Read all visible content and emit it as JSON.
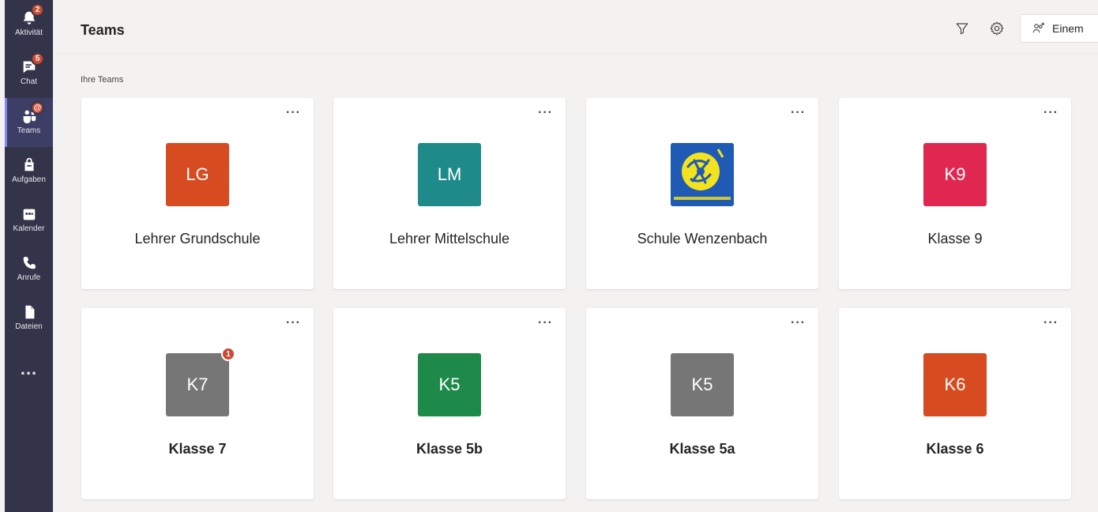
{
  "rail": {
    "items": [
      {
        "label": "Aktivität",
        "badge": "2",
        "icon": "bell-icon"
      },
      {
        "label": "Chat",
        "badge": "5",
        "icon": "chat-icon"
      },
      {
        "label": "Teams",
        "badge": "@",
        "icon": "teams-icon",
        "active": true
      },
      {
        "label": "Aufgaben",
        "badge": "",
        "icon": "assignments-icon"
      },
      {
        "label": "Kalender",
        "badge": "",
        "icon": "calendar-icon"
      },
      {
        "label": "Anrufe",
        "badge": "",
        "icon": "phone-icon"
      },
      {
        "label": "Dateien",
        "badge": "",
        "icon": "files-icon"
      }
    ],
    "more": "..."
  },
  "header": {
    "title": "Teams",
    "join_label": "Einem"
  },
  "section": {
    "label": "Ihre Teams"
  },
  "teams": [
    {
      "initials": "LG",
      "name": "Lehrer Grundschule",
      "color": "#d74b20",
      "bold": false,
      "badge": ""
    },
    {
      "initials": "LM",
      "name": "Lehrer Mittelschule",
      "color": "#1f8a8a",
      "bold": false,
      "badge": ""
    },
    {
      "initials": "",
      "name": "Schule Wenzenbach",
      "color": "#1f5bb5",
      "bold": false,
      "badge": "",
      "logo": true
    },
    {
      "initials": "K9",
      "name": "Klasse 9",
      "color": "#e02750",
      "bold": false,
      "badge": ""
    },
    {
      "initials": "K7",
      "name": "Klasse 7",
      "color": "#767676",
      "bold": true,
      "badge": "1"
    },
    {
      "initials": "K5",
      "name": "Klasse 5b",
      "color": "#1e8a4a",
      "bold": true,
      "badge": ""
    },
    {
      "initials": "K5",
      "name": "Klasse 5a",
      "color": "#767676",
      "bold": true,
      "badge": ""
    },
    {
      "initials": "K6",
      "name": "Klasse 6",
      "color": "#d74b20",
      "bold": true,
      "badge": ""
    }
  ],
  "card_menu": "···"
}
